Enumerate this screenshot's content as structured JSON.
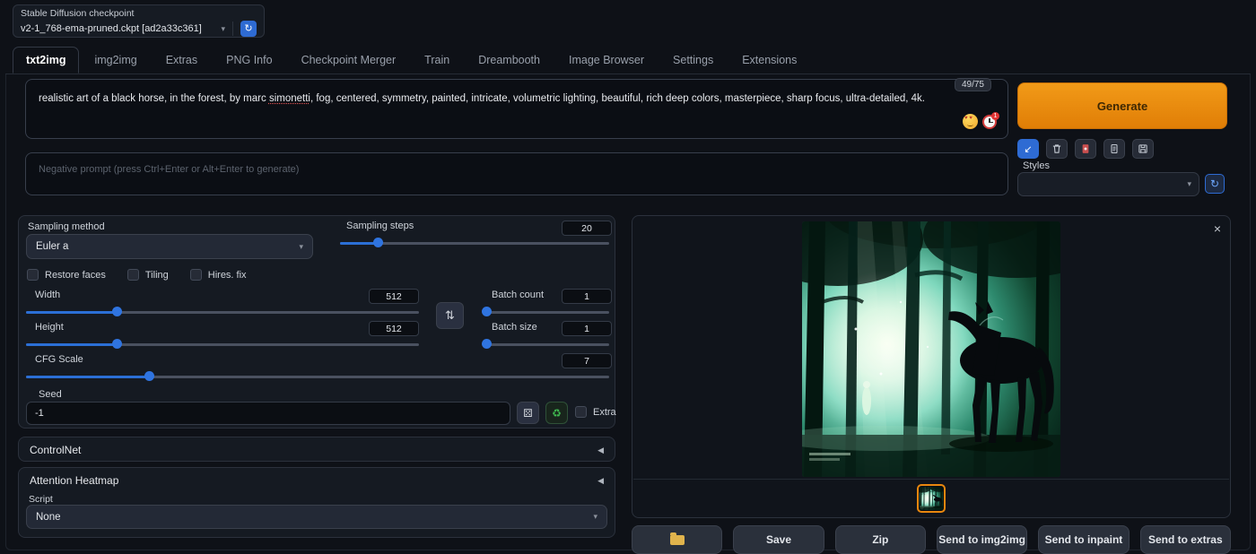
{
  "app": {
    "checkpoint_label": "Stable Diffusion checkpoint",
    "checkpoint_value": "v2-1_768-ema-pruned.ckpt [ad2a33c361]"
  },
  "tabs": [
    {
      "label": "txt2img"
    },
    {
      "label": "img2img"
    },
    {
      "label": "Extras"
    },
    {
      "label": "PNG Info"
    },
    {
      "label": "Checkpoint Merger"
    },
    {
      "label": "Train"
    },
    {
      "label": "Dreambooth"
    },
    {
      "label": "Image Browser"
    },
    {
      "label": "Settings"
    },
    {
      "label": "Extensions"
    }
  ],
  "prompt": {
    "text_before": "realistic art of a black horse, in the forest, by marc ",
    "misspelled_word": "simonetti",
    "text_after": ", fog, centered, symmetry, painted, intricate, volumetric lighting, beautiful, rich deep colors, masterpiece, sharp focus, ultra-detailed, 4k.",
    "token_counter": "49/75",
    "clock_badge": "1",
    "negative_placeholder": "Negative prompt (press Ctrl+Enter or Alt+Enter to generate)"
  },
  "generate": {
    "label": "Generate"
  },
  "styles": {
    "label": "Styles"
  },
  "params": {
    "sampling_method_label": "Sampling method",
    "sampling_method_value": "Euler a",
    "sampling_steps_label": "Sampling steps",
    "sampling_steps_value": "20",
    "restore_faces_label": "Restore faces",
    "tiling_label": "Tiling",
    "hires_fix_label": "Hires. fix",
    "width_label": "Width",
    "width_value": "512",
    "height_label": "Height",
    "height_value": "512",
    "batch_count_label": "Batch count",
    "batch_count_value": "1",
    "batch_size_label": "Batch size",
    "batch_size_value": "1",
    "cfg_label": "CFG Scale",
    "cfg_value": "7",
    "seed_label": "Seed",
    "seed_value": "-1",
    "extra_label": "Extra"
  },
  "sections": {
    "controlnet": "ControlNet",
    "attention_heatmap": "Attention Heatmap",
    "script_label": "Script",
    "script_value": "None"
  },
  "gallery": {
    "close": "×",
    "actions": {
      "save": "Save",
      "zip": "Zip",
      "send_img2img": "Send to img2img",
      "send_inpaint": "Send to inpaint",
      "send_extras": "Send to extras"
    }
  },
  "icons": {
    "refresh": "↻",
    "caret": "▾",
    "collapse": "◀",
    "die": "⚄",
    "recycle": "♻",
    "swap": "⇅",
    "read_params": "↙"
  },
  "colors": {
    "accent_orange": "#e8870e",
    "accent_blue": "#2b6fd6",
    "accent_green": "#3fb950"
  }
}
